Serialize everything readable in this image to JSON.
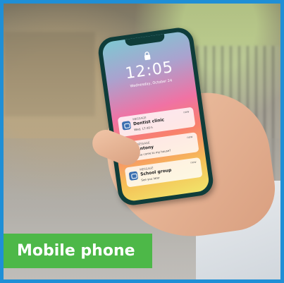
{
  "caption": "Mobile phone",
  "lock_screen": {
    "time": "12:05",
    "date": "Wednesday, October 24"
  },
  "notifications": [
    {
      "kind": "MESSAGE",
      "title": "Dentist clinic",
      "body": "Wed, 17:30 h",
      "when": "now"
    },
    {
      "kind": "MESSAGE",
      "title": "Antony",
      "body": "You come to my house?",
      "when": "now"
    },
    {
      "kind": "MESSAGE",
      "title": "School group",
      "body": "See you later",
      "when": "now"
    }
  ],
  "colors": {
    "frame": "#1f8fd6",
    "caption_bg": "#4db848",
    "caption_text": "#ffffff",
    "phone_body": "#0f3d3a"
  },
  "icons": [
    "lock-icon",
    "message-icon"
  ]
}
